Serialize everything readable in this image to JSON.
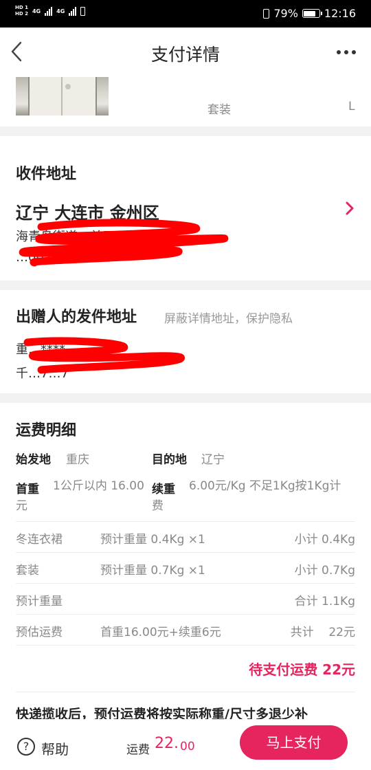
{
  "status_bar": {
    "hd1": "HD 1",
    "hd2": "HD 2",
    "sig1": "4G",
    "sig2": "4G",
    "battery_percent": "79%",
    "time": "12:16",
    "battery_level": 0.79
  },
  "nav": {
    "title": "支付详情",
    "back_icon": "chevron-left-icon",
    "more_icon": "more-horizontal-icon"
  },
  "product": {
    "type": "套装",
    "size": "L"
  },
  "recipient": {
    "section_title": "收件地址",
    "region": "辽宁 大连市 金州区",
    "line1": "海青岛街道…单元",
    "line2": "…0020"
  },
  "sender": {
    "section_title": "出赠人的发件地址",
    "hint": "屏蔽详情地址，保护隐私",
    "line1": "重…****",
    "line2": "千…7…7"
  },
  "shipping": {
    "section_title": "运费明细",
    "origin_label": "始发地",
    "origin_value": "重庆",
    "dest_label": "目的地",
    "dest_value": "辽宁",
    "first_weight_label": "首重",
    "first_weight_value": "1公斤以内 16.00元",
    "extra_weight_label": "续重",
    "extra_weight_value": "6.00元/Kg 不足1Kg按1Kg计费",
    "rows": [
      {
        "name": "冬连衣裙",
        "detail": "预计重量 0.4Kg ×1",
        "summary": "小计 0.4Kg"
      },
      {
        "name": "套装",
        "detail": "预计重量 0.7Kg ×1",
        "summary": "小计 0.7Kg"
      },
      {
        "name": "预计重量",
        "detail": "",
        "summary": "合计 1.1Kg"
      },
      {
        "name": "预估运费",
        "detail": "首重16.00元+续重6元",
        "summary": "共计    22元"
      }
    ],
    "pending_text": "待支付运费 22元",
    "notice": "快递揽收后，预付运费将按实际称重/尺寸多退少补"
  },
  "bottom_bar": {
    "help_label": "帮助",
    "fee_label": "运费",
    "fee_amount": "22.",
    "fee_decimal": "00",
    "pay_label": "马上支付"
  },
  "colors": {
    "accent": "#e6245e",
    "redaction": "#ff0000",
    "divider": "#f2f2f2"
  }
}
